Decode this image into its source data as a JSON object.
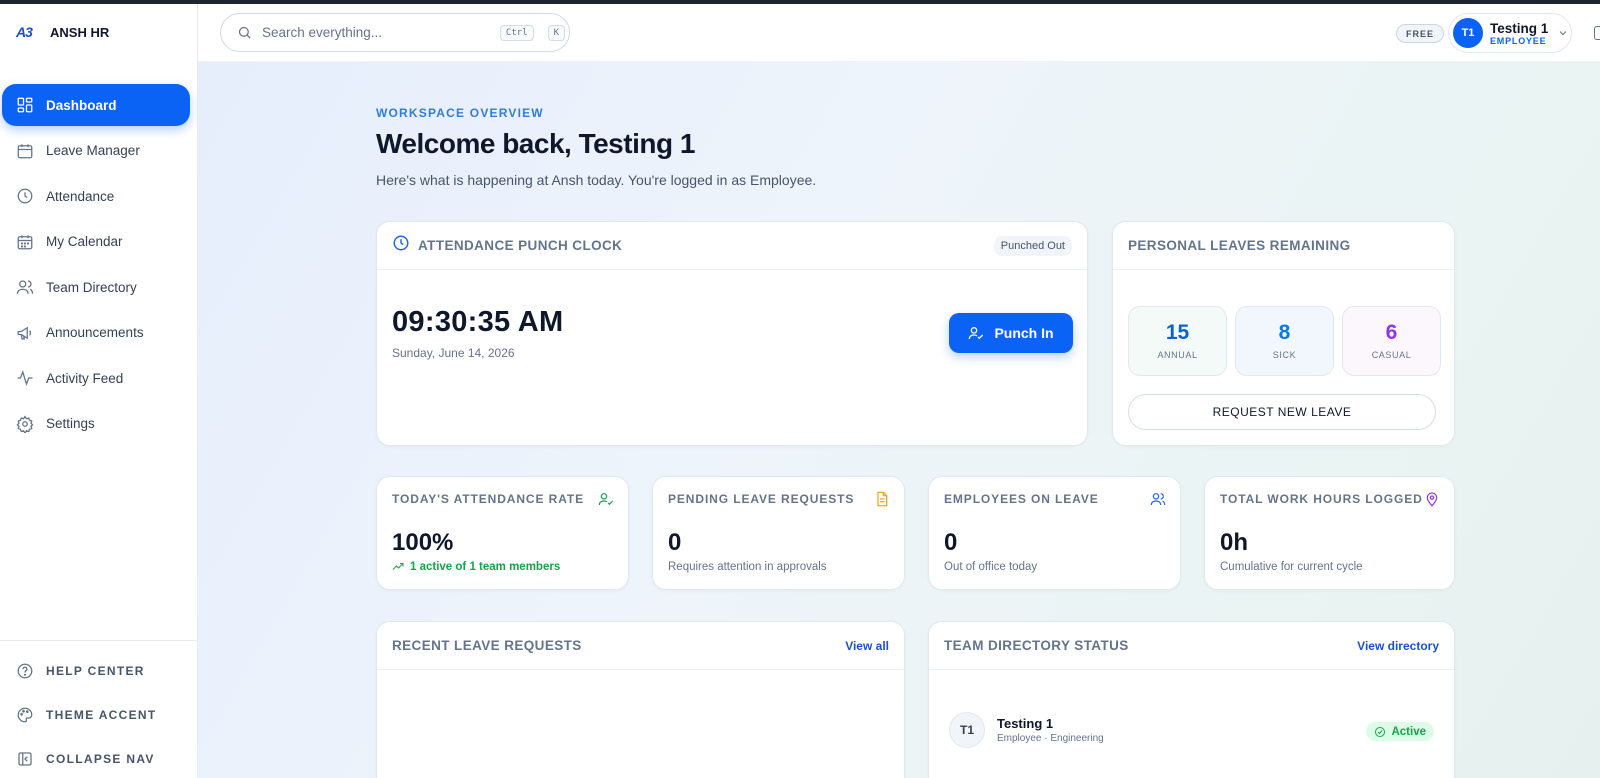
{
  "brand": {
    "logo_text": "A3",
    "name": "ANSH HR"
  },
  "sidebar": {
    "items": [
      {
        "label": "Dashboard",
        "icon": "grid-icon",
        "active": true
      },
      {
        "label": "Leave Manager",
        "icon": "calendar-icon"
      },
      {
        "label": "Attendance",
        "icon": "clock-icon"
      },
      {
        "label": "My Calendar",
        "icon": "calendar-grid-icon"
      },
      {
        "label": "Team Directory",
        "icon": "users-icon"
      },
      {
        "label": "Announcements",
        "icon": "megaphone-icon"
      },
      {
        "label": "Activity Feed",
        "icon": "activity-icon"
      },
      {
        "label": "Settings",
        "icon": "gear-icon"
      }
    ],
    "bottom": [
      {
        "label": "HELP CENTER",
        "icon": "help-icon"
      },
      {
        "label": "THEME ACCENT",
        "icon": "palette-icon"
      },
      {
        "label": "COLLAPSE NAV",
        "icon": "collapse-icon"
      }
    ]
  },
  "header": {
    "search_placeholder": "Search everything...",
    "shortcut": [
      "Ctrl",
      "K"
    ],
    "plan": "FREE",
    "user": {
      "initials": "T1",
      "name": "Testing 1",
      "role": "EMPLOYEE"
    }
  },
  "main": {
    "eyebrow": "WORKSPACE OVERVIEW",
    "title": "Welcome back, Testing 1",
    "subtitle": "Here's what is happening at Ansh today. You're logged in as Employee."
  },
  "punch": {
    "title": "ATTENDANCE PUNCH CLOCK",
    "status": "Punched Out",
    "time": "09:30:35 AM",
    "date": "Sunday, June 14, 2026",
    "button": "Punch In"
  },
  "leaves": {
    "title": "PERSONAL LEAVES REMAINING",
    "items": [
      {
        "value": "15",
        "label": "ANNUAL",
        "color": "#0b63c9"
      },
      {
        "value": "8",
        "label": "SICK",
        "color": "#0b7be0"
      },
      {
        "value": "6",
        "label": "CASUAL",
        "color": "#9333ea"
      }
    ],
    "request_button": "REQUEST NEW LEAVE"
  },
  "stats": [
    {
      "label": "TODAY'S ATTENDANCE RATE",
      "value": "100%",
      "sub": "1 active of 1 team members",
      "icon": "user-check-icon",
      "icon_color": "#16a34a"
    },
    {
      "label": "PENDING LEAVE REQUESTS",
      "value": "0",
      "sub": "Requires attention in approvals",
      "icon": "document-icon",
      "icon_color": "#f59e0b"
    },
    {
      "label": "EMPLOYEES ON LEAVE",
      "value": "0",
      "sub": "Out of office today",
      "icon": "users-icon",
      "icon_color": "#2563eb"
    },
    {
      "label": "TOTAL WORK HOURS LOGGED",
      "value": "0h",
      "sub": "Cumulative for current cycle",
      "icon": "map-pin-icon",
      "icon_color": "#9333ea"
    }
  ],
  "recent": {
    "title": "RECENT LEAVE REQUESTS",
    "link": "View all"
  },
  "directory": {
    "title": "TEAM DIRECTORY STATUS",
    "link": "View directory",
    "member": {
      "initials": "T1",
      "name": "Testing 1",
      "sub": "Employee · Engineering",
      "status": "Active"
    }
  }
}
